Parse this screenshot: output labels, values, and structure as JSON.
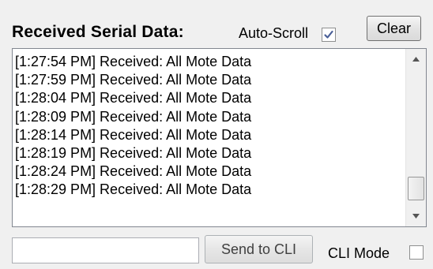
{
  "header": {
    "title": "Received Serial Data:",
    "autoscroll_label": "Auto-Scroll",
    "autoscroll_checked": true,
    "clear_label": "Clear"
  },
  "log": {
    "lines": [
      "[1:27:54 PM] Received: All Mote Data",
      "[1:27:59 PM] Received: All Mote Data",
      "[1:28:04 PM] Received: All Mote Data",
      "[1:28:09 PM] Received: All Mote Data",
      "[1:28:14 PM] Received: All Mote Data",
      "[1:28:19 PM] Received: All Mote Data",
      "[1:28:24 PM] Received: All Mote Data",
      "[1:28:29 PM] Received: All Mote Data"
    ]
  },
  "footer": {
    "cli_input_value": "",
    "send_label": "Send to CLI",
    "cli_mode_label": "CLI Mode",
    "cli_mode_checked": false
  },
  "icons": {
    "checkmark": "checkmark-icon",
    "scroll_up": "scroll-up-arrow-icon",
    "scroll_down": "scroll-down-arrow-icon"
  },
  "colors": {
    "checkmark": "#4a5f97",
    "window_bg": "#f0f0f0"
  }
}
